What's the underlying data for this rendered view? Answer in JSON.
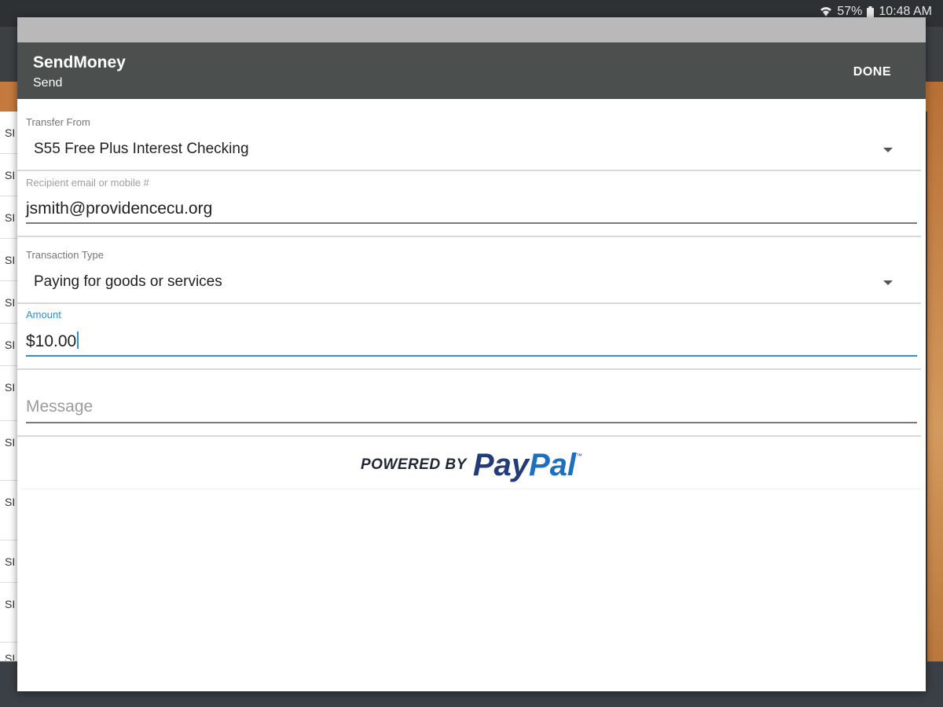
{
  "status_bar": {
    "battery": "57%",
    "time": "10:48 AM"
  },
  "background_list": {
    "rows": [
      "SI",
      "SI",
      "SI",
      "SI",
      "SI",
      "SI",
      "SI",
      "SI",
      "SI",
      "SI",
      "SI",
      "SI"
    ]
  },
  "dialog": {
    "title": "SendMoney",
    "subtitle": "Send",
    "done_label": "DONE"
  },
  "form": {
    "transfer_from": {
      "label": "Transfer From",
      "value": "S55 Free Plus Interest Checking"
    },
    "recipient": {
      "label": "Recipient email or mobile #",
      "value": "jsmith@providencecu.org"
    },
    "transaction_type": {
      "label": "Transaction Type",
      "value": "Paying for goods or services"
    },
    "amount": {
      "label": "Amount",
      "value": "$10.00"
    },
    "message": {
      "placeholder": "Message",
      "value": ""
    }
  },
  "footer": {
    "powered_by": "POWERED BY",
    "brand_pay": "Pay",
    "brand_pal": "Pal",
    "trademark": "™"
  },
  "colors": {
    "header": "#4b4f4d",
    "accent_blue": "#2e8fd0",
    "paypal_dark": "#243b7a",
    "paypal_light": "#1d6fbf"
  }
}
